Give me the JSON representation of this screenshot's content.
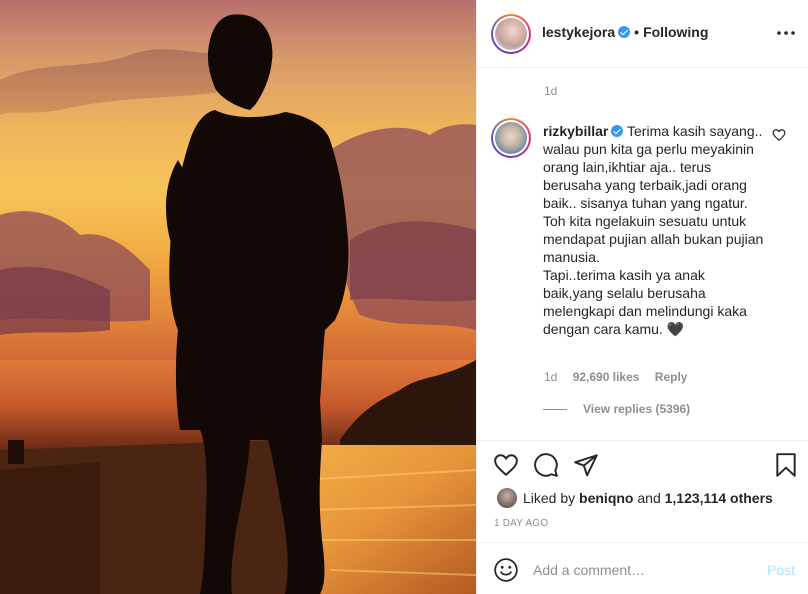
{
  "header": {
    "username": "lestykejora",
    "separator": "•",
    "follow_status": "Following"
  },
  "post": {
    "time_ago": "1d",
    "comment": {
      "username": "rizkybillar",
      "text": "Terima kasih sayang.. walau pun kita ga perlu meyakinin orang lain,ikhtiar aja.. terus berusaha yang terbaik,jadi orang baik.. sisanya tuhan yang ngatur.\nToh kita ngelakuin sesuatu untuk mendapat pujian allah bukan pujian manusia.\nTapi..terima kasih ya anak baik,yang selalu berusaha melengkapi dan melindungi kaka dengan cara kamu. 🖤",
      "time": "1d",
      "likes": "92,690 likes",
      "reply": "Reply",
      "view_replies": "View replies (5396)"
    },
    "liked_by": {
      "prefix": "Liked by",
      "user": "beniqno",
      "middle": "and",
      "others": "1,123,114 others"
    },
    "date": "1 DAY AGO"
  },
  "comment_box": {
    "placeholder": "Add a comment…",
    "post_label": "Post"
  },
  "icons": {
    "more": "more-options-icon",
    "like": "heart-icon",
    "comment": "comment-icon",
    "share": "share-icon",
    "save": "bookmark-icon",
    "emoji": "smile-icon"
  },
  "colors": {
    "verified": "#3897f0",
    "muted_text": "#8e8e8e",
    "post_disabled": "#b2dffc"
  }
}
